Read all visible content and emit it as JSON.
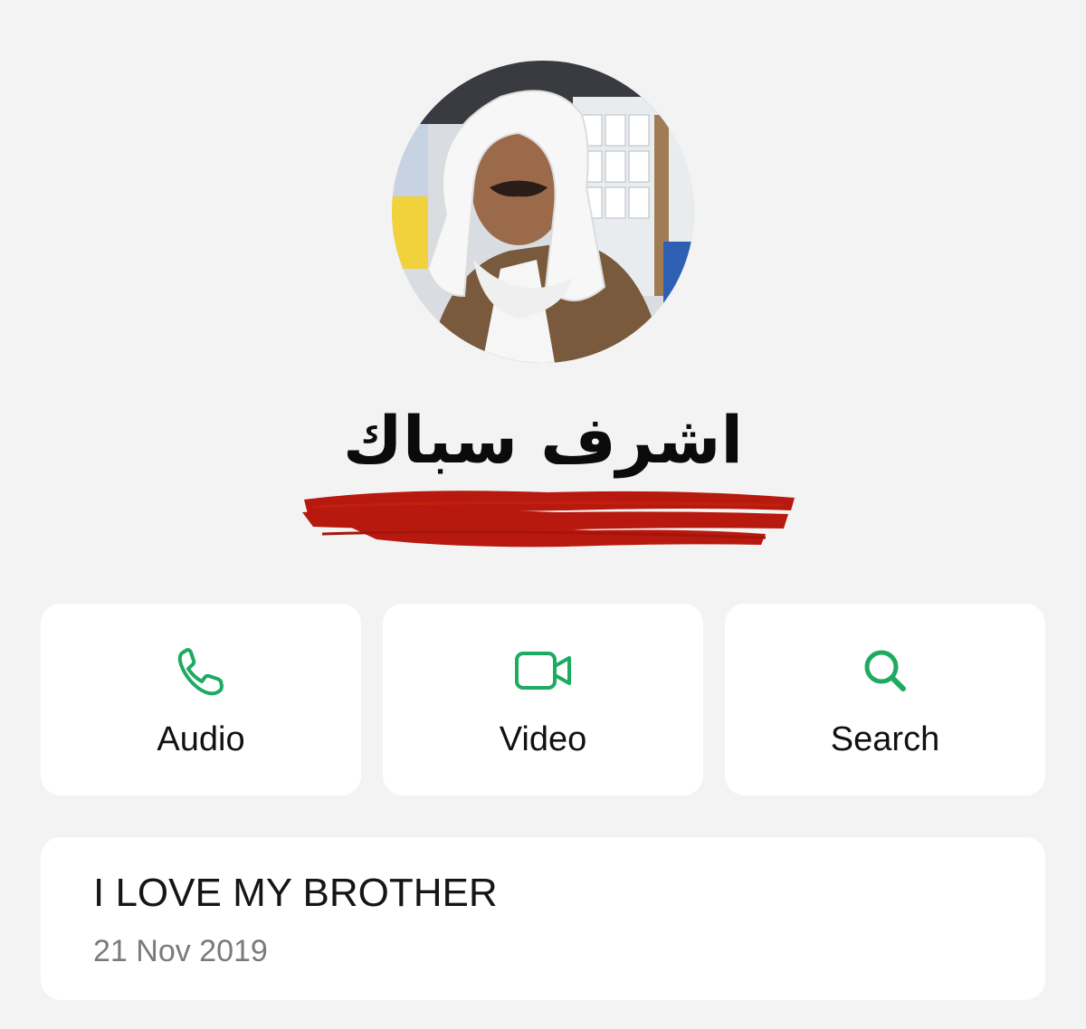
{
  "profile": {
    "name": "اشرف سباك"
  },
  "actions": [
    {
      "label": "Audio",
      "icon": "phone-icon"
    },
    {
      "label": "Video",
      "icon": "video-camera-icon"
    },
    {
      "label": "Search",
      "icon": "search-icon"
    }
  ],
  "about": {
    "text": "I LOVE MY BROTHER",
    "date": "21 Nov 2019"
  },
  "colors": {
    "background": "#f3f3f3",
    "card": "#ffffff",
    "accent_green": "#1daa61",
    "redaction_red": "#b8190e",
    "secondary_text": "#7a7a7a"
  }
}
